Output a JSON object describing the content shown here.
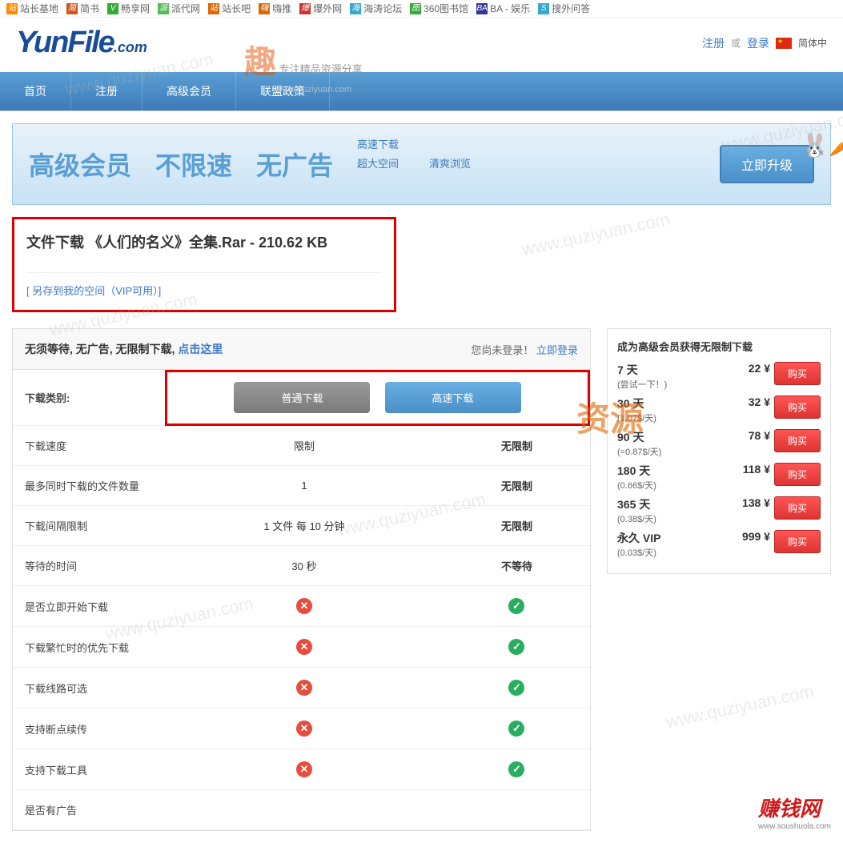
{
  "bookmarks": {
    "b0": "站长基地",
    "b1": "简书",
    "b2": "畅享网",
    "b3": "派代网",
    "b4": "站长吧",
    "b5": "嗨推",
    "b6": "爆外网",
    "b7": "海涛论坛",
    "b8": "360图书馆",
    "b9": "BA - 娱乐",
    "b10": "搜外问答"
  },
  "logo": {
    "main": "YunFile",
    "suffix": ".com"
  },
  "header": {
    "register": "注册",
    "or": "或",
    "login": "登录",
    "lang": "简体中"
  },
  "nav": {
    "n0": "首页",
    "n1": "注册",
    "n2": "高级会员",
    "n3": "联盟政策"
  },
  "banner": {
    "t0": "高级会员",
    "t1": "不限速",
    "t2": "无广告",
    "tag0": "高速下载",
    "tag1": "超大空间",
    "tag2": "清爽浏览",
    "upgrade": "立即升级"
  },
  "file": {
    "title_prefix": "文件下载 ",
    "title": "《人们的名义》全集.Rar - 210.62 KB",
    "save": "[ 另存到我的空间（VIP可用）]"
  },
  "table": {
    "header_left_a": "无须等待, 无广告, 无限制下载, ",
    "header_left_b": "点击这里",
    "header_right_a": "您尚未登录！",
    "header_right_b": "立即登录",
    "cat_label": "下载类别:",
    "btn_normal": "普通下载",
    "btn_fast": "高速下载",
    "rows": {
      "r0": {
        "label": "下载速度",
        "c1": "限制",
        "c2": "无限制"
      },
      "r1": {
        "label": "最多同时下载的文件数量",
        "c1": "1",
        "c2": "无限制"
      },
      "r2": {
        "label": "下载间隔限制",
        "c1": "1 文件 每 10 分钟",
        "c2": "无限制"
      },
      "r3": {
        "label": "等待的时间",
        "c1": "30 秒",
        "c2": "不等待"
      },
      "r4": {
        "label": "是否立即开始下载"
      },
      "r5": {
        "label": "下载繁忙时的优先下载"
      },
      "r6": {
        "label": "下载线路可选"
      },
      "r7": {
        "label": "支持断点续传"
      },
      "r8": {
        "label": "支持下载工具"
      },
      "r9": {
        "label": "是否有广告"
      }
    }
  },
  "sidebar": {
    "title": "成为高级会员获得无限制下载",
    "buy": "购买",
    "plans": {
      "p0": {
        "name": "7 天",
        "sub": "(尝试一下！)",
        "price": "22 ¥"
      },
      "p1": {
        "name": "30 天",
        "sub": "(1.07$/天)",
        "price": "32 ¥"
      },
      "p2": {
        "name": "90 天",
        "sub": "(=0.87$/天)",
        "price": "78 ¥"
      },
      "p3": {
        "name": "180 天",
        "sub": "(0.66$/天)",
        "price": "118 ¥"
      },
      "p4": {
        "name": "365 天",
        "sub": "(0.38$/天)",
        "price": "138 ¥"
      },
      "p5": {
        "name": "永久 VIP",
        "sub": "(0.03$/天)",
        "price": "999 ¥"
      }
    }
  },
  "watermark": {
    "url": "www.quziyuan.com",
    "zi": "资源",
    "qu": "趣",
    "tagline": "专注精品资源分享",
    "zhuan": "赚钱网",
    "zhuan_url": "www.soushuola.com"
  }
}
